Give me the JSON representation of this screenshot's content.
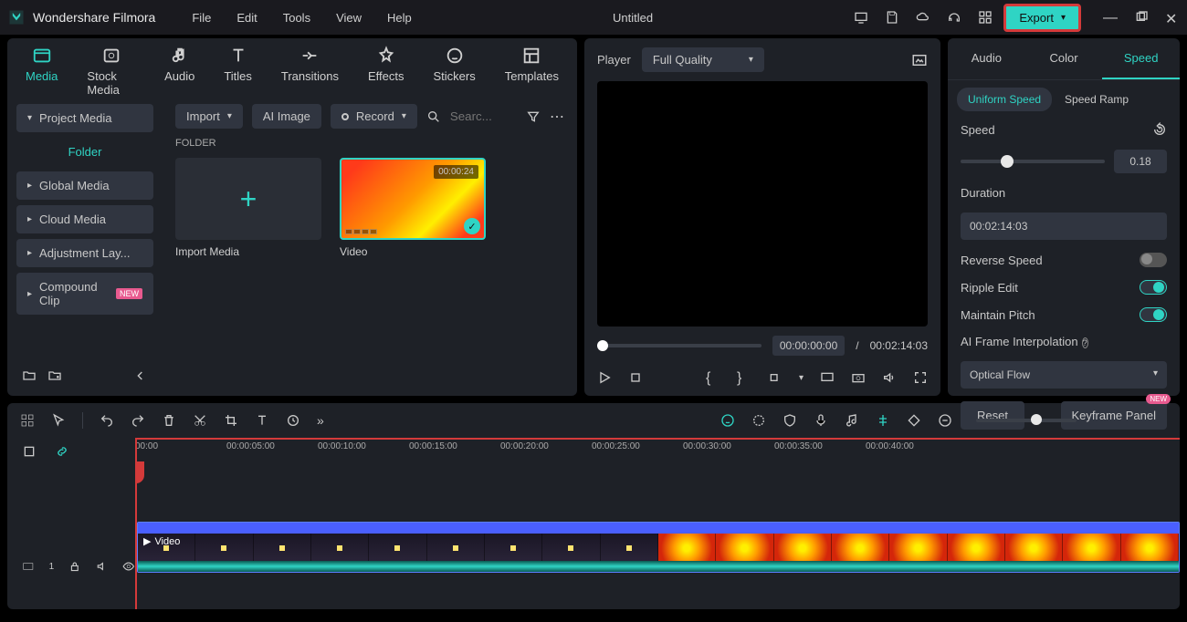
{
  "app": {
    "name": "Wondershare Filmora",
    "doc": "Untitled"
  },
  "menu": [
    "File",
    "Edit",
    "Tools",
    "View",
    "Help"
  ],
  "export_label": "Export",
  "lib_tabs": [
    "Media",
    "Stock Media",
    "Audio",
    "Titles",
    "Transitions",
    "Effects",
    "Stickers",
    "Templates"
  ],
  "sidebar": {
    "project": "Project Media",
    "folder": "Folder",
    "items": [
      "Global Media",
      "Cloud Media",
      "Adjustment Lay...",
      "Compound Clip"
    ],
    "new_badge": "NEW"
  },
  "lib_toolbar": {
    "import": "Import",
    "ai": "AI Image",
    "record": "Record",
    "search_ph": "Searc..."
  },
  "folder_label": "FOLDER",
  "media": {
    "import_caption": "Import Media",
    "video_caption": "Video",
    "video_duration": "00:00:24"
  },
  "player": {
    "label": "Player",
    "quality": "Full Quality",
    "cur": "00:00:00:00",
    "sep": "/",
    "total": "00:02:14:03"
  },
  "inspector": {
    "tabs": [
      "Audio",
      "Color",
      "Speed"
    ],
    "sub": {
      "uniform": "Uniform Speed",
      "ramp": "Speed Ramp"
    },
    "speed_label": "Speed",
    "speed_value": "0.18",
    "duration_label": "Duration",
    "duration_value": "00:02:14:03",
    "reverse": "Reverse Speed",
    "ripple": "Ripple Edit",
    "pitch": "Maintain Pitch",
    "aiframe": "AI Frame Interpolation",
    "aiframe_value": "Optical Flow",
    "reset": "Reset",
    "keyframe": "Keyframe Panel",
    "new_badge": "NEW"
  },
  "timeline": {
    "marks": [
      "00:00",
      "00:00:05:00",
      "00:00:10:00",
      "00:00:15:00",
      "00:00:20:00",
      "00:00:25:00",
      "00:00:30:00",
      "00:00:35:00",
      "00:00:40:00"
    ],
    "clip_label": "Video",
    "track_badge": "1"
  }
}
